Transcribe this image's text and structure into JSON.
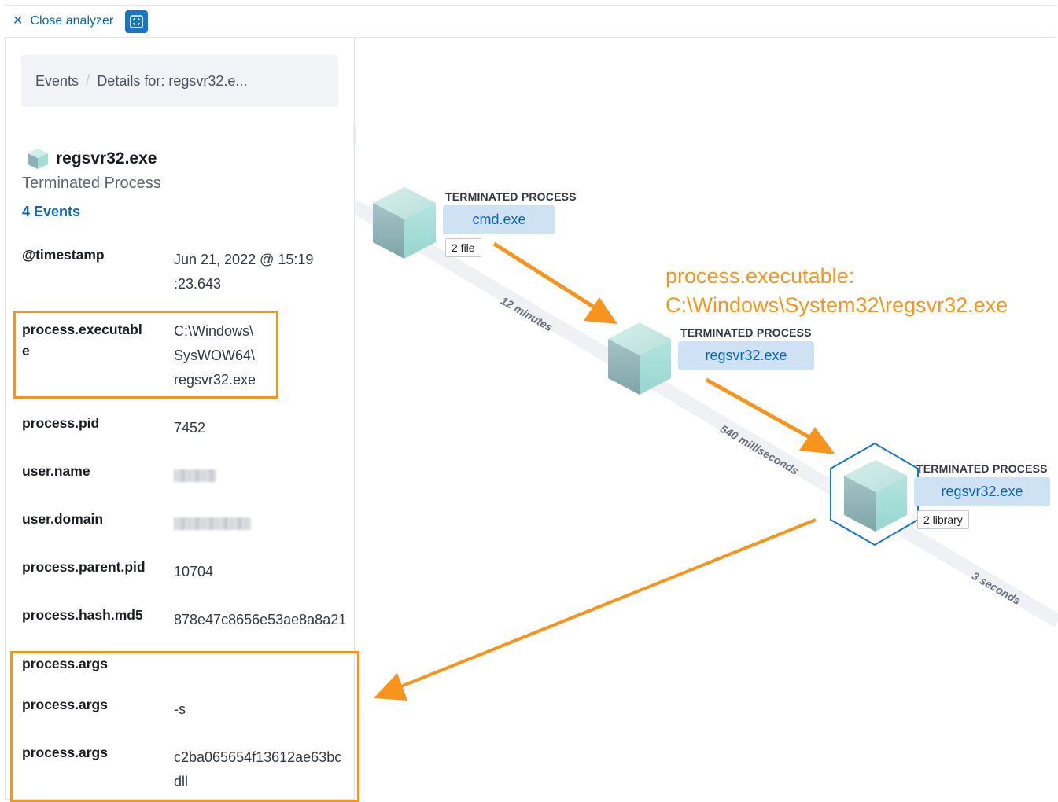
{
  "topbar": {
    "close_label": "Close analyzer"
  },
  "panel": {
    "breadcrumb": [
      "Events",
      "Details for: regsvr32.e..."
    ],
    "node_title": "regsvr32.exe",
    "node_subtitle": "Terminated Process",
    "events_link": "4 Events",
    "fields": {
      "timestamp_label": "@timestamp",
      "timestamp_value_1": "Jun 21, 2022 @ 15:19",
      "timestamp_value_2": ":23.643",
      "exec_label_1": "process.executabl",
      "exec_label_2": "e",
      "exec_value_1": "C:\\Windows\\",
      "exec_value_2": "SysWOW64\\",
      "exec_value_3": "regsvr32.exe",
      "pid_label": "process.pid",
      "pid_value": "7452",
      "username_label": "user.name",
      "userdomain_label": "user.domain",
      "ppid_label": "process.parent.pid",
      "ppid_value": "10704",
      "md5_label": "process.hash.md5",
      "md5_value": "878e47c8656e53ae8a8a21",
      "args_label_1": "process.args",
      "args_label_2": "process.args",
      "args_value_2": "-s",
      "args_label_3": "process.args",
      "args_value_3_1": "c2ba065654f13612ae63bc",
      "args_value_3_2": "dll"
    }
  },
  "graph": {
    "nodes": [
      {
        "type": "TERMINATED PROCESS",
        "name": "cmd.exe",
        "badge": "2 file"
      },
      {
        "type": "TERMINATED PROCESS",
        "name": "regsvr32.exe"
      },
      {
        "type": "TERMINATED PROCESS",
        "name": "regsvr32.exe",
        "badge": "2 library"
      }
    ],
    "edges": [
      "12 minutes",
      "540 milliseconds",
      "3 seconds"
    ],
    "annotation_line_1": "process.executable:",
    "annotation_line_2": "C:\\Windows\\System32\\regsvr32.exe"
  },
  "colors": {
    "accent_blue": "#0b64b7",
    "highlight_orange": "#f7941d",
    "node_button_bg": "#cfe2f4"
  }
}
